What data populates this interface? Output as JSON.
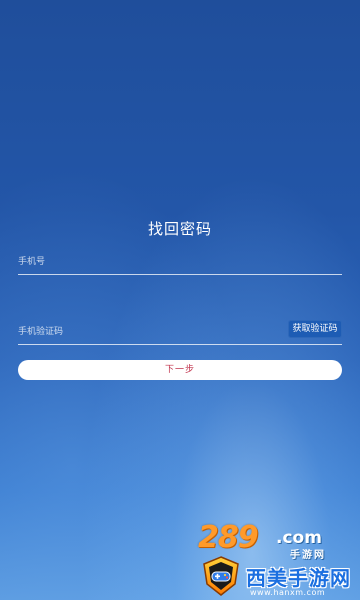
{
  "page": {
    "title": "找回密码"
  },
  "form": {
    "phone_placeholder": "手机号",
    "phone_value": "",
    "code_placeholder": "手机验证码",
    "code_value": "",
    "get_code_label": "获取验证码",
    "next_label": "下一步"
  },
  "watermark": {
    "brand_number": "289",
    "brand_domain": ".com",
    "brand_sub": "手游网",
    "brand_name": "西美手游网",
    "brand_url": "www.hanxm.com"
  },
  "colors": {
    "background_top": "#1f4e9b",
    "background_bottom": "#5b9be0",
    "code_button": "#1d5cb4",
    "next_text": "#c0304a"
  }
}
